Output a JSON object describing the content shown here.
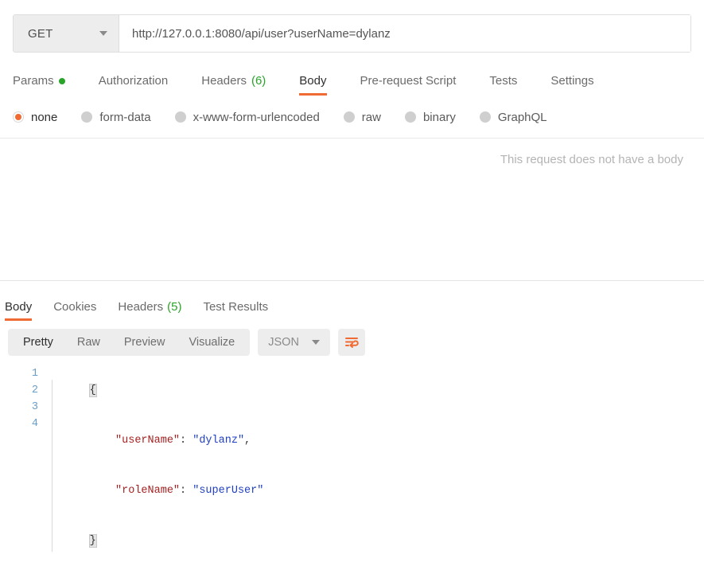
{
  "request": {
    "method": "GET",
    "method_caret_icon": "chevron-down-icon",
    "url": "http://127.0.0.1:8080/api/user?userName=dylanz",
    "url_placeholder": "Enter request URL",
    "tabs": [
      {
        "label": "Params",
        "badge": "",
        "badge_type": "dot",
        "active": false
      },
      {
        "label": "Authorization",
        "badge": "",
        "badge_type": "",
        "active": false
      },
      {
        "label": "Headers",
        "badge": "(6)",
        "badge_type": "count",
        "active": false
      },
      {
        "label": "Body",
        "badge": "",
        "badge_type": "",
        "active": true
      },
      {
        "label": "Pre-request Script",
        "badge": "",
        "badge_type": "",
        "active": false
      },
      {
        "label": "Tests",
        "badge": "",
        "badge_type": "",
        "active": false
      },
      {
        "label": "Settings",
        "badge": "",
        "badge_type": "",
        "active": false
      }
    ],
    "body_types": [
      {
        "label": "none",
        "selected": true
      },
      {
        "label": "form-data",
        "selected": false
      },
      {
        "label": "x-www-form-urlencoded",
        "selected": false
      },
      {
        "label": "raw",
        "selected": false
      },
      {
        "label": "binary",
        "selected": false
      },
      {
        "label": "GraphQL",
        "selected": false
      }
    ],
    "empty_body_message": "This request does not have a body"
  },
  "response": {
    "tabs": [
      {
        "label": "Body",
        "badge": "",
        "active": true
      },
      {
        "label": "Cookies",
        "badge": "",
        "active": false
      },
      {
        "label": "Headers",
        "badge": "(5)",
        "active": false
      },
      {
        "label": "Test Results",
        "badge": "",
        "active": false
      }
    ],
    "view_modes": [
      {
        "label": "Pretty",
        "active": true
      },
      {
        "label": "Raw",
        "active": false
      },
      {
        "label": "Preview",
        "active": false
      },
      {
        "label": "Visualize",
        "active": false
      }
    ],
    "language": "JSON",
    "language_caret_icon": "chevron-down-icon",
    "wrap_button_icon": "word-wrap-icon",
    "code": {
      "line_numbers": [
        "1",
        "2",
        "3",
        "4"
      ],
      "lines": [
        {
          "open_brace": "{"
        },
        {
          "indent": "    ",
          "key": "\"userName\"",
          "colon": ": ",
          "value": "\"dylanz\"",
          "trail": ","
        },
        {
          "indent": "    ",
          "key": "\"roleName\"",
          "colon": ": ",
          "value": "\"superUser\"",
          "trail": ""
        },
        {
          "close_brace": "}"
        }
      ]
    }
  },
  "colors": {
    "accent_orange": "#ef6b33",
    "badge_green": "#2aa329",
    "json_key": "#a52121",
    "json_string": "#1f3fbf",
    "gutter_blue": "#6a9ec9",
    "control_gray": "#ededed"
  }
}
